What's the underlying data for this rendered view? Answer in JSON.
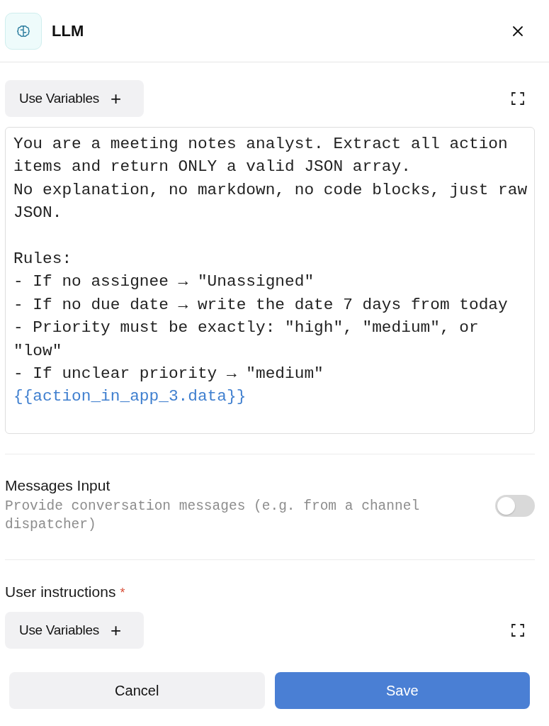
{
  "header": {
    "title": "LLM"
  },
  "system_instructions": {
    "variables_button": "Use Variables",
    "plus": "+",
    "text": "You are a meeting notes analyst. Extract all action items and return ONLY a valid JSON array.\nNo explanation, no markdown, no code blocks, just raw JSON.\n\nRules:\n- If no assignee → \"Unassigned\"\n- If no due date → write the date 7 days from today\n- Priority must be exactly: \"high\", \"medium\", or \"low\"\n- If unclear priority → \"medium\"",
    "variable": "{{action_in_app_3.data}}"
  },
  "messages_input": {
    "label": "Messages Input",
    "description": "Provide conversation messages (e.g. from a channel dispatcher)",
    "on": false
  },
  "user_instructions": {
    "label": "User instructions",
    "required": true,
    "required_mark": "*",
    "variables_button": "Use Variables",
    "plus": "+"
  },
  "buttons": [
    {
      "label": "Cancel",
      "kind": "secondary"
    },
    {
      "label": "Save",
      "kind": "primary"
    }
  ]
}
